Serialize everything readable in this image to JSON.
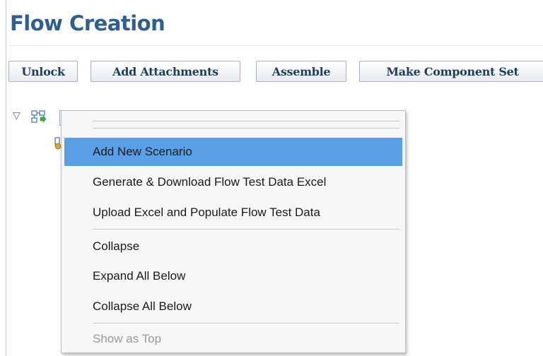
{
  "page": {
    "title": "Flow Creation"
  },
  "toolbar": {
    "unlock_label": "Unlock",
    "add_attachments_label": "Add Attachments",
    "assemble_label": "Assemble",
    "make_component_set_label": "Make Component Set"
  },
  "tree": {
    "expand_toggle": "▽",
    "root_icon": "flow-tree-icon",
    "child_icon": "scenario-icon"
  },
  "context_menu": {
    "items": [
      {
        "label": "Add New Scenario",
        "state": "highlighted"
      },
      {
        "label": "Generate & Download Flow Test Data Excel",
        "state": "normal"
      },
      {
        "label": "Upload Excel and Populate Flow Test Data",
        "state": "normal"
      },
      {
        "label": "Collapse",
        "state": "normal"
      },
      {
        "label": "Expand All Below",
        "state": "normal"
      },
      {
        "label": "Collapse All Below",
        "state": "normal"
      },
      {
        "label": "Show as Top",
        "state": "disabled"
      }
    ]
  },
  "colors": {
    "title": "#2e5f90",
    "highlight": "#5aa0e6",
    "disabled_text": "#9a9a9a",
    "menu_background": "#f7f7f7"
  }
}
